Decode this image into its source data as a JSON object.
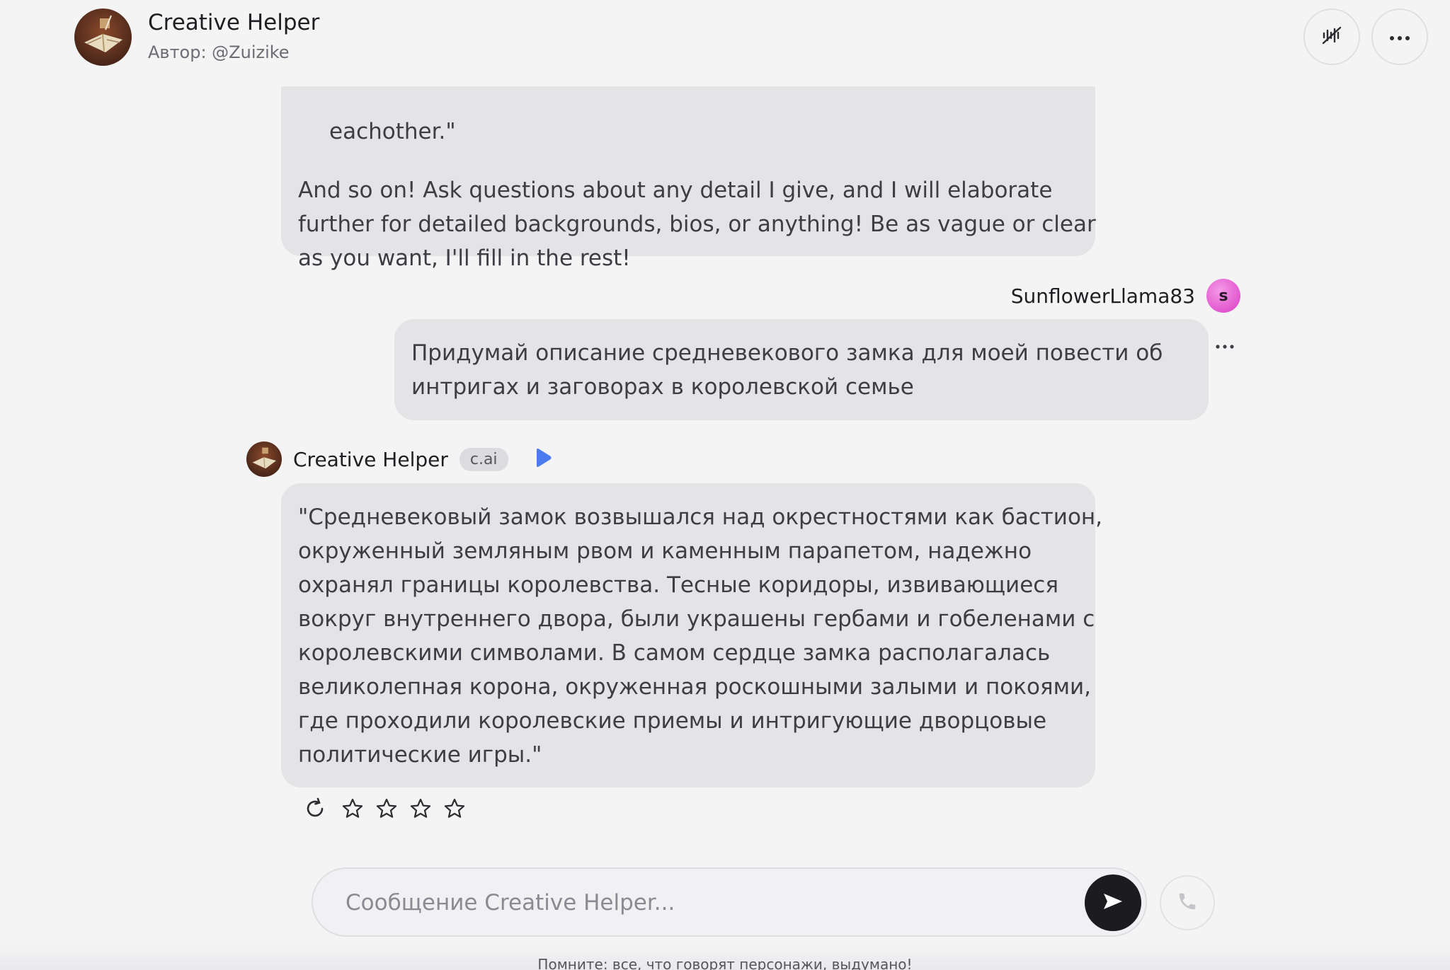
{
  "header": {
    "title": "Creative Helper",
    "author": "Автор: @Zuizike"
  },
  "messages": {
    "previous_bot": {
      "lead_line": "eachother.\"",
      "lines": [
        "And so on! Ask questions about any detail I give, and I will elaborate",
        "further for detailed backgrounds, bios, or anything! Be as vague or clear",
        "as you want, I'll fill in the rest!"
      ]
    },
    "user": {
      "name": "SunflowerLlama83",
      "avatar_letter": "s",
      "lines": [
        "Придумай описание средневекового замка для моей повести об",
        "интригах и заговорах в королевской семье"
      ]
    },
    "bot": {
      "name": "Creative Helper",
      "badge": "c.ai",
      "lines": [
        "\"Средневековый замок возвышался над окрестностями как бастион,",
        "окруженный земляным рвом и каменным парапетом, надежно",
        "охранял границы королевства. Тесные коридоры, извивающиеся",
        "вокруг внутреннего двора, были украшены гербами и гобеленами с",
        "королевскими символами. В самом сердце замка располагалась",
        "великолепная корона, окруженная роскошными залыми и покоями,",
        "где проходили королевские приемы и интригующие дворцовые",
        "политические игры.\""
      ],
      "rating": 0,
      "rating_max": 4
    }
  },
  "composer": {
    "placeholder": "Сообщение Creative Helper..."
  },
  "disclaimer": "Помните: все, что говорят персонажи, выдумано!",
  "colors": {
    "background": "#f4f4f5",
    "bubble": "#e4e4e7",
    "play_accent": "#4a7cf0",
    "user_avatar": "#e55bd0",
    "send_button": "#1c1c20"
  }
}
